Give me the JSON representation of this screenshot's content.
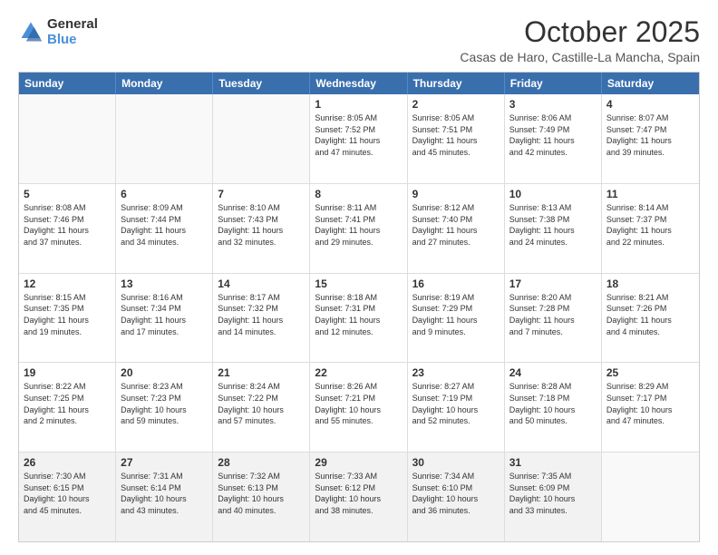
{
  "logo": {
    "line1": "General",
    "line2": "Blue"
  },
  "title": "October 2025",
  "subtitle": "Casas de Haro, Castille-La Mancha, Spain",
  "days_of_week": [
    "Sunday",
    "Monday",
    "Tuesday",
    "Wednesday",
    "Thursday",
    "Friday",
    "Saturday"
  ],
  "weeks": [
    {
      "cells": [
        {
          "day": null,
          "text": null
        },
        {
          "day": null,
          "text": null
        },
        {
          "day": null,
          "text": null
        },
        {
          "day": "1",
          "text": "Sunrise: 8:05 AM\nSunset: 7:52 PM\nDaylight: 11 hours\nand 47 minutes."
        },
        {
          "day": "2",
          "text": "Sunrise: 8:05 AM\nSunset: 7:51 PM\nDaylight: 11 hours\nand 45 minutes."
        },
        {
          "day": "3",
          "text": "Sunrise: 8:06 AM\nSunset: 7:49 PM\nDaylight: 11 hours\nand 42 minutes."
        },
        {
          "day": "4",
          "text": "Sunrise: 8:07 AM\nSunset: 7:47 PM\nDaylight: 11 hours\nand 39 minutes."
        }
      ]
    },
    {
      "cells": [
        {
          "day": "5",
          "text": "Sunrise: 8:08 AM\nSunset: 7:46 PM\nDaylight: 11 hours\nand 37 minutes."
        },
        {
          "day": "6",
          "text": "Sunrise: 8:09 AM\nSunset: 7:44 PM\nDaylight: 11 hours\nand 34 minutes."
        },
        {
          "day": "7",
          "text": "Sunrise: 8:10 AM\nSunset: 7:43 PM\nDaylight: 11 hours\nand 32 minutes."
        },
        {
          "day": "8",
          "text": "Sunrise: 8:11 AM\nSunset: 7:41 PM\nDaylight: 11 hours\nand 29 minutes."
        },
        {
          "day": "9",
          "text": "Sunrise: 8:12 AM\nSunset: 7:40 PM\nDaylight: 11 hours\nand 27 minutes."
        },
        {
          "day": "10",
          "text": "Sunrise: 8:13 AM\nSunset: 7:38 PM\nDaylight: 11 hours\nand 24 minutes."
        },
        {
          "day": "11",
          "text": "Sunrise: 8:14 AM\nSunset: 7:37 PM\nDaylight: 11 hours\nand 22 minutes."
        }
      ]
    },
    {
      "cells": [
        {
          "day": "12",
          "text": "Sunrise: 8:15 AM\nSunset: 7:35 PM\nDaylight: 11 hours\nand 19 minutes."
        },
        {
          "day": "13",
          "text": "Sunrise: 8:16 AM\nSunset: 7:34 PM\nDaylight: 11 hours\nand 17 minutes."
        },
        {
          "day": "14",
          "text": "Sunrise: 8:17 AM\nSunset: 7:32 PM\nDaylight: 11 hours\nand 14 minutes."
        },
        {
          "day": "15",
          "text": "Sunrise: 8:18 AM\nSunset: 7:31 PM\nDaylight: 11 hours\nand 12 minutes."
        },
        {
          "day": "16",
          "text": "Sunrise: 8:19 AM\nSunset: 7:29 PM\nDaylight: 11 hours\nand 9 minutes."
        },
        {
          "day": "17",
          "text": "Sunrise: 8:20 AM\nSunset: 7:28 PM\nDaylight: 11 hours\nand 7 minutes."
        },
        {
          "day": "18",
          "text": "Sunrise: 8:21 AM\nSunset: 7:26 PM\nDaylight: 11 hours\nand 4 minutes."
        }
      ]
    },
    {
      "cells": [
        {
          "day": "19",
          "text": "Sunrise: 8:22 AM\nSunset: 7:25 PM\nDaylight: 11 hours\nand 2 minutes."
        },
        {
          "day": "20",
          "text": "Sunrise: 8:23 AM\nSunset: 7:23 PM\nDaylight: 10 hours\nand 59 minutes."
        },
        {
          "day": "21",
          "text": "Sunrise: 8:24 AM\nSunset: 7:22 PM\nDaylight: 10 hours\nand 57 minutes."
        },
        {
          "day": "22",
          "text": "Sunrise: 8:26 AM\nSunset: 7:21 PM\nDaylight: 10 hours\nand 55 minutes."
        },
        {
          "day": "23",
          "text": "Sunrise: 8:27 AM\nSunset: 7:19 PM\nDaylight: 10 hours\nand 52 minutes."
        },
        {
          "day": "24",
          "text": "Sunrise: 8:28 AM\nSunset: 7:18 PM\nDaylight: 10 hours\nand 50 minutes."
        },
        {
          "day": "25",
          "text": "Sunrise: 8:29 AM\nSunset: 7:17 PM\nDaylight: 10 hours\nand 47 minutes."
        }
      ]
    },
    {
      "cells": [
        {
          "day": "26",
          "text": "Sunrise: 7:30 AM\nSunset: 6:15 PM\nDaylight: 10 hours\nand 45 minutes."
        },
        {
          "day": "27",
          "text": "Sunrise: 7:31 AM\nSunset: 6:14 PM\nDaylight: 10 hours\nand 43 minutes."
        },
        {
          "day": "28",
          "text": "Sunrise: 7:32 AM\nSunset: 6:13 PM\nDaylight: 10 hours\nand 40 minutes."
        },
        {
          "day": "29",
          "text": "Sunrise: 7:33 AM\nSunset: 6:12 PM\nDaylight: 10 hours\nand 38 minutes."
        },
        {
          "day": "30",
          "text": "Sunrise: 7:34 AM\nSunset: 6:10 PM\nDaylight: 10 hours\nand 36 minutes."
        },
        {
          "day": "31",
          "text": "Sunrise: 7:35 AM\nSunset: 6:09 PM\nDaylight: 10 hours\nand 33 minutes."
        },
        {
          "day": null,
          "text": null
        }
      ]
    }
  ]
}
